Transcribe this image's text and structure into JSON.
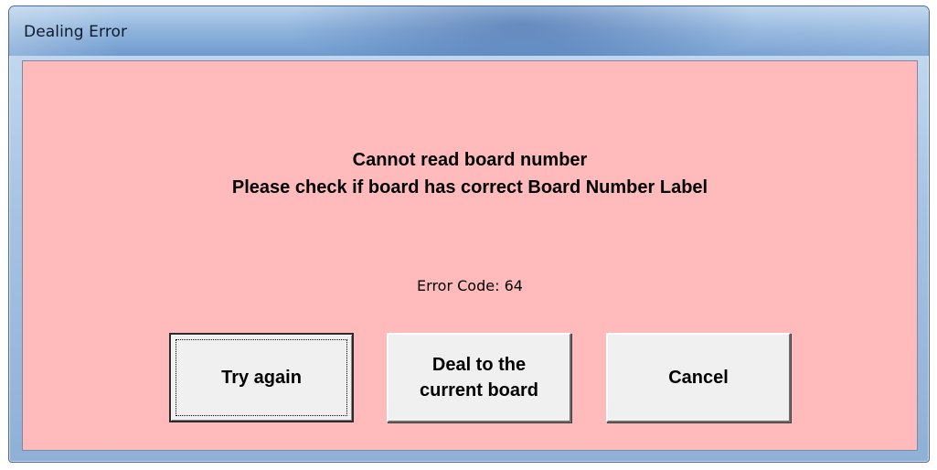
{
  "window": {
    "title": "Dealing Error"
  },
  "message": {
    "line1": "Cannot read board number",
    "line2": "Please check if board has correct Board Number Label"
  },
  "error_code": "Error Code: 64",
  "buttons": {
    "try_again": "Try again",
    "deal_current": "Deal to the\ncurrent board",
    "cancel": "Cancel"
  },
  "colors": {
    "client_background": "#ffbbbb",
    "button_face": "#f0f0f0"
  }
}
